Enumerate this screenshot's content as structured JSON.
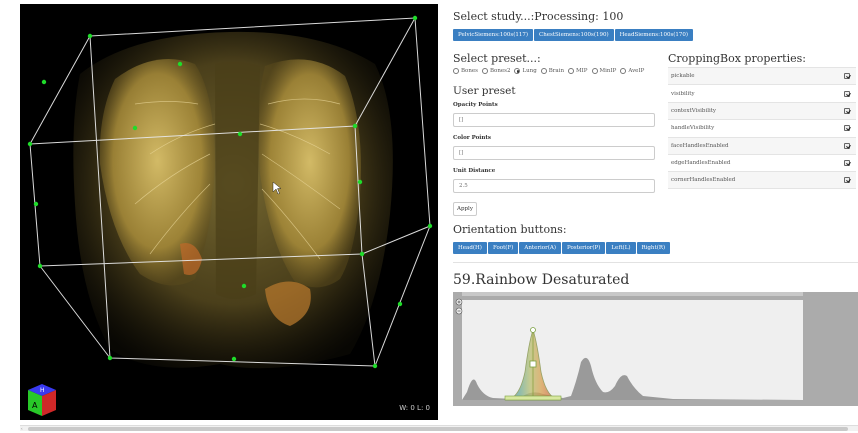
{
  "study": {
    "title": "Select study...:Processing: 100",
    "buttons": [
      "PelvicSiemens:100s(117)",
      "ChestSiemens:100s(190)",
      "HeadSiemens:100s(170)"
    ]
  },
  "preset": {
    "title": "Select preset...:",
    "options": [
      "Bones",
      "Bones2",
      "Lung",
      "Brain",
      "MIP",
      "MinIP",
      "AveIP"
    ],
    "selected": "Lung"
  },
  "user_preset": {
    "title": "User preset",
    "opacity_label": "Opacity Points",
    "opacity_value": "[]",
    "color_label": "Color Points",
    "color_value": "[]",
    "unit_label": "Unit Distance",
    "unit_placeholder": "2.5",
    "apply_label": "Apply"
  },
  "orientation": {
    "title": "Orientation buttons:",
    "buttons": [
      "Head(H)",
      "Foot(F)",
      "Anterior(A)",
      "Posterior(P)",
      "Left(L)",
      "Right(R)"
    ]
  },
  "cropping": {
    "title": "CroppingBox properties:",
    "props": [
      {
        "name": "pickable",
        "checked": true
      },
      {
        "name": "visibility",
        "checked": true
      },
      {
        "name": "contextVisibility",
        "checked": true
      },
      {
        "name": "handleVisibility",
        "checked": true
      },
      {
        "name": "faceHandlesEnabled",
        "checked": true
      },
      {
        "name": "edgeHandlesEnabled",
        "checked": true
      },
      {
        "name": "cornerHandlesEnabled",
        "checked": true
      }
    ]
  },
  "colormap": {
    "title": "59.Rainbow Desaturated"
  },
  "viewport": {
    "wl_readout": "W: 0 L: 0",
    "orientation_cube": {
      "top": "H",
      "front": "A"
    }
  },
  "colors": {
    "accent": "#3a7fc2",
    "handle": "#1fdc2a",
    "volume": "#b89a32"
  }
}
